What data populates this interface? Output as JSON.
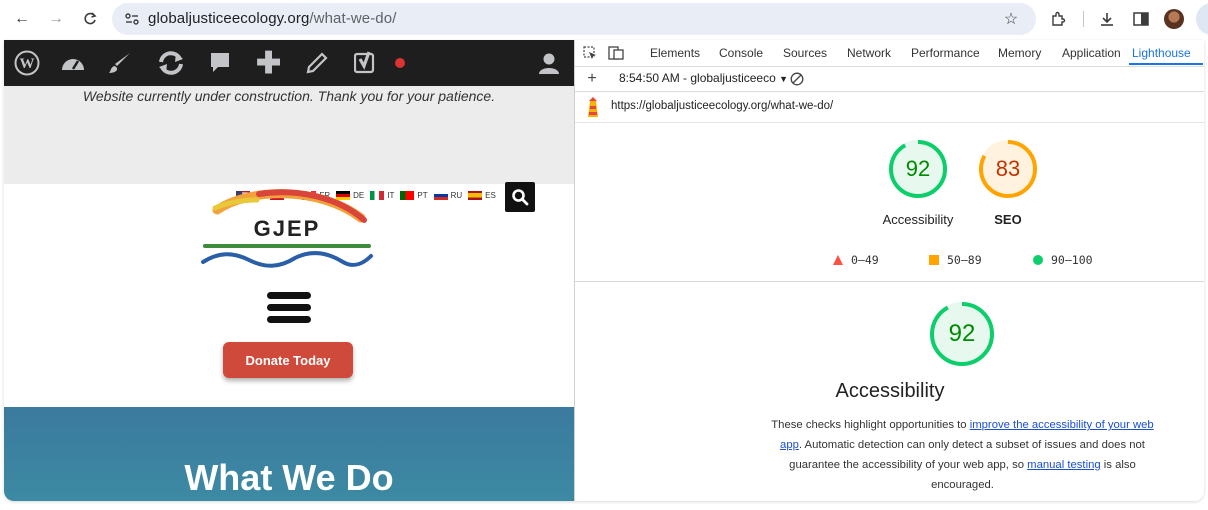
{
  "browser": {
    "url_domain": "globaljusticeecology.org",
    "url_path": "/what-we-do/"
  },
  "site": {
    "notice": "Website currently under construction. Thank you for your patience.",
    "languages": [
      "EN",
      "TL",
      "FR",
      "DE",
      "IT",
      "PT",
      "RU",
      "ES"
    ],
    "logo_text": "GJEP",
    "donate_label": "Donate Today",
    "hero_title": "What We Do"
  },
  "devtools": {
    "tabs": [
      "Elements",
      "Console",
      "Sources",
      "Network",
      "Performance",
      "Memory",
      "Application",
      "Lighthouse"
    ],
    "active_tab": "Lighthouse",
    "report_selector": "8:54:50 AM - globaljusticeeco",
    "audited_url": "https://globaljusticeecology.org/what-we-do/",
    "scores": [
      {
        "label": "Accessibility",
        "value": 92,
        "color": "#0cce6b"
      },
      {
        "label": "SEO",
        "value": 83,
        "color": "#ffa400"
      }
    ],
    "legend": [
      {
        "range": "0–49",
        "color": "#ff4e42",
        "shape": "triangle"
      },
      {
        "range": "50–89",
        "color": "#ffa400",
        "shape": "square"
      },
      {
        "range": "90–100",
        "color": "#0cce6b",
        "shape": "circle"
      }
    ],
    "section": {
      "score": 92,
      "title": "Accessibility",
      "desc_1": "These checks highlight opportunities to ",
      "link_1": "improve the accessibility of your web app",
      "desc_2": ". Automatic detection can only detect a subset of issues and does not guarantee the accessibility of your web app, so ",
      "link_2": "manual testing",
      "desc_3": " is also encouraged."
    }
  },
  "colors": {
    "pass": "#0cce6b",
    "average": "#ffa400",
    "fail": "#ff4e42",
    "donate": "#d04a3c",
    "hero": "#3b7a9e"
  }
}
